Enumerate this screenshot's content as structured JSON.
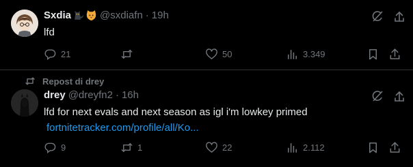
{
  "tweet1": {
    "name": "Sxdia",
    "handle": "@sxdiafn",
    "time": "19h",
    "text": "lfd",
    "stats": {
      "replies": "21",
      "retweets": "",
      "likes": "50",
      "views": "3.349"
    },
    "icons": [
      "black-cat-emoji-icon",
      "cat-face-emoji-icon",
      "grok-icon",
      "more-icon"
    ]
  },
  "tweet2": {
    "repost_label": "Repost di drey",
    "name": "drey",
    "handle": "@dreyfn2",
    "time": "16h",
    "text": "lfd for next evals and next season as igl i'm lowkey primed",
    "link": "fortnitetracker.com/profile/all/Ko...",
    "stats": {
      "replies": "9",
      "retweets": "1",
      "likes": "22",
      "views": "2.112"
    }
  },
  "separator": "·",
  "colors": {
    "background": "#000000",
    "text": "#e7e9ea",
    "muted": "#71767b",
    "link": "#1d9bf0",
    "divider": "#2f3336"
  }
}
